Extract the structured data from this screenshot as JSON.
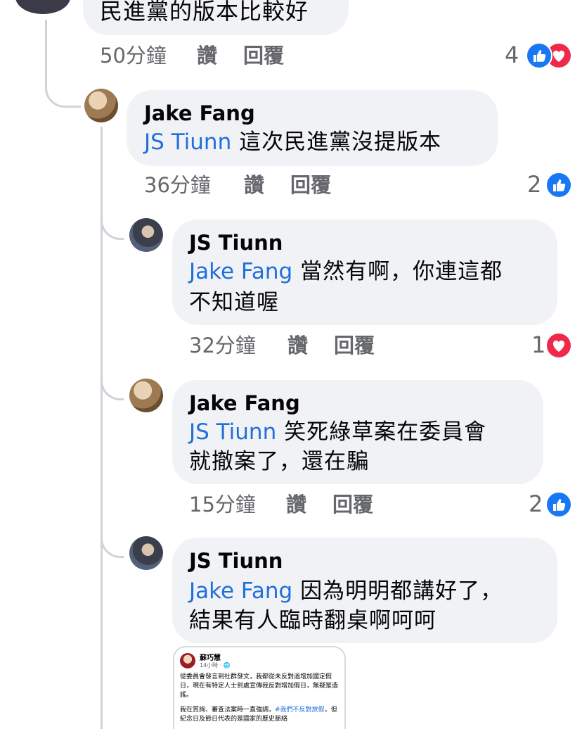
{
  "top_comment": {
    "text": "民進黨的版本比較好",
    "time": "50分鐘",
    "like_label": "讚",
    "reply_label": "回覆",
    "reaction_count": "4",
    "reactions": [
      "like-icon",
      "love-icon"
    ]
  },
  "replies": [
    {
      "author": "Jake Fang",
      "mention": "JS Tiunn",
      "text_lines": [
        " 這次民進黨沒提版本"
      ],
      "time": "36分鐘",
      "like_label": "讚",
      "reply_label": "回覆",
      "reaction_count": "2",
      "reactions": [
        "like-icon"
      ]
    },
    {
      "author": "JS Tiunn",
      "mention": "Jake Fang",
      "text_lines": [
        " 當然有啊，你連這都",
        "不知道喔"
      ],
      "time": "32分鐘",
      "like_label": "讚",
      "reply_label": "回覆",
      "reaction_count": "1",
      "reactions": [
        "love-icon"
      ]
    },
    {
      "author": "Jake Fang",
      "mention": "JS Tiunn",
      "text_lines": [
        " 笑死綠草案在委員會",
        "就撤案了，還在騙"
      ],
      "time": "15分鐘",
      "like_label": "讚",
      "reply_label": "回覆",
      "reaction_count": "2",
      "reactions": [
        "like-icon"
      ]
    },
    {
      "author": "JS Tiunn",
      "mention": "Jake Fang",
      "text_lines": [
        " 因為明明都講好了，",
        "結果有人臨時翻桌啊呵呵"
      ]
    }
  ],
  "shared_post": {
    "author": "蘇巧慧",
    "time": "14小時 · ",
    "para1": "從委員會發言到社群發文，我都從未反對過增加國定假日，現在有特定人士到處宣傳我反對增加假日，無疑是造謠。",
    "para2_before": "我在質詢、審查法案時一直強調，",
    "para2_tag": "#我們不反對放假",
    "para2_after": "，但紀念日及節日代表的是國家的歷史脈絡"
  },
  "colors": {
    "bubble_bg": "#f0f2f5",
    "mention": "#216fdb",
    "meta": "#65676b",
    "like": "#1877f2",
    "love": "#f0284a"
  }
}
